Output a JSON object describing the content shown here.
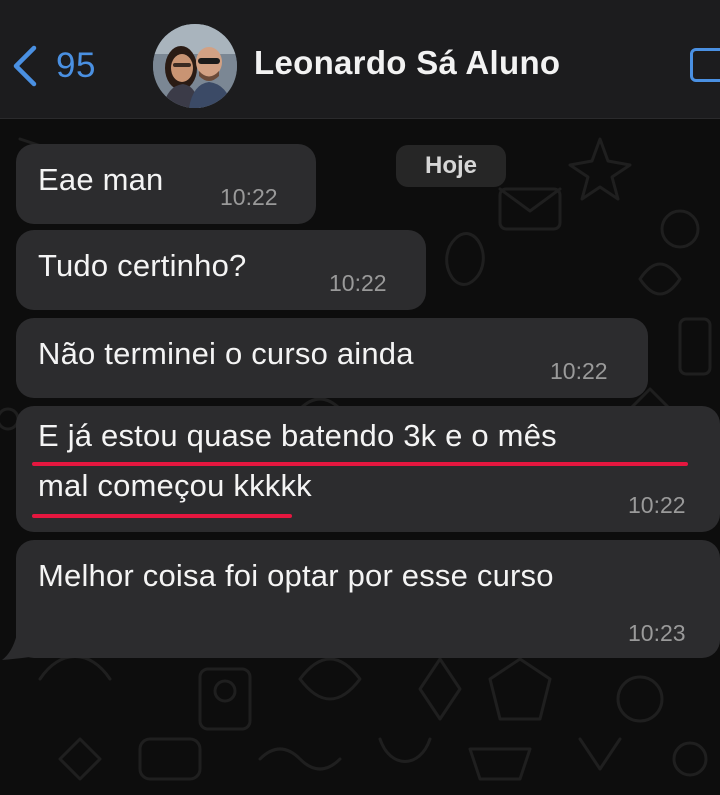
{
  "header": {
    "back_count": "95",
    "contact_name": "Leonardo Sá Aluno",
    "accent_color": "#4a90e2"
  },
  "chat": {
    "date_chip": "Hoje",
    "messages": [
      {
        "text": "Eae man",
        "time": "10:22"
      },
      {
        "text": "Tudo certinho?",
        "time": "10:22"
      },
      {
        "text": "Não terminei o curso ainda",
        "time": "10:22"
      },
      {
        "text_line1": "E já estou quase batendo 3k e o mês",
        "text_line2": "mal começou kkkkk",
        "time": "10:22",
        "highlight_color": "#e5173f"
      },
      {
        "text": "Melhor coisa foi optar por esse curso",
        "time": "10:23"
      }
    ]
  }
}
